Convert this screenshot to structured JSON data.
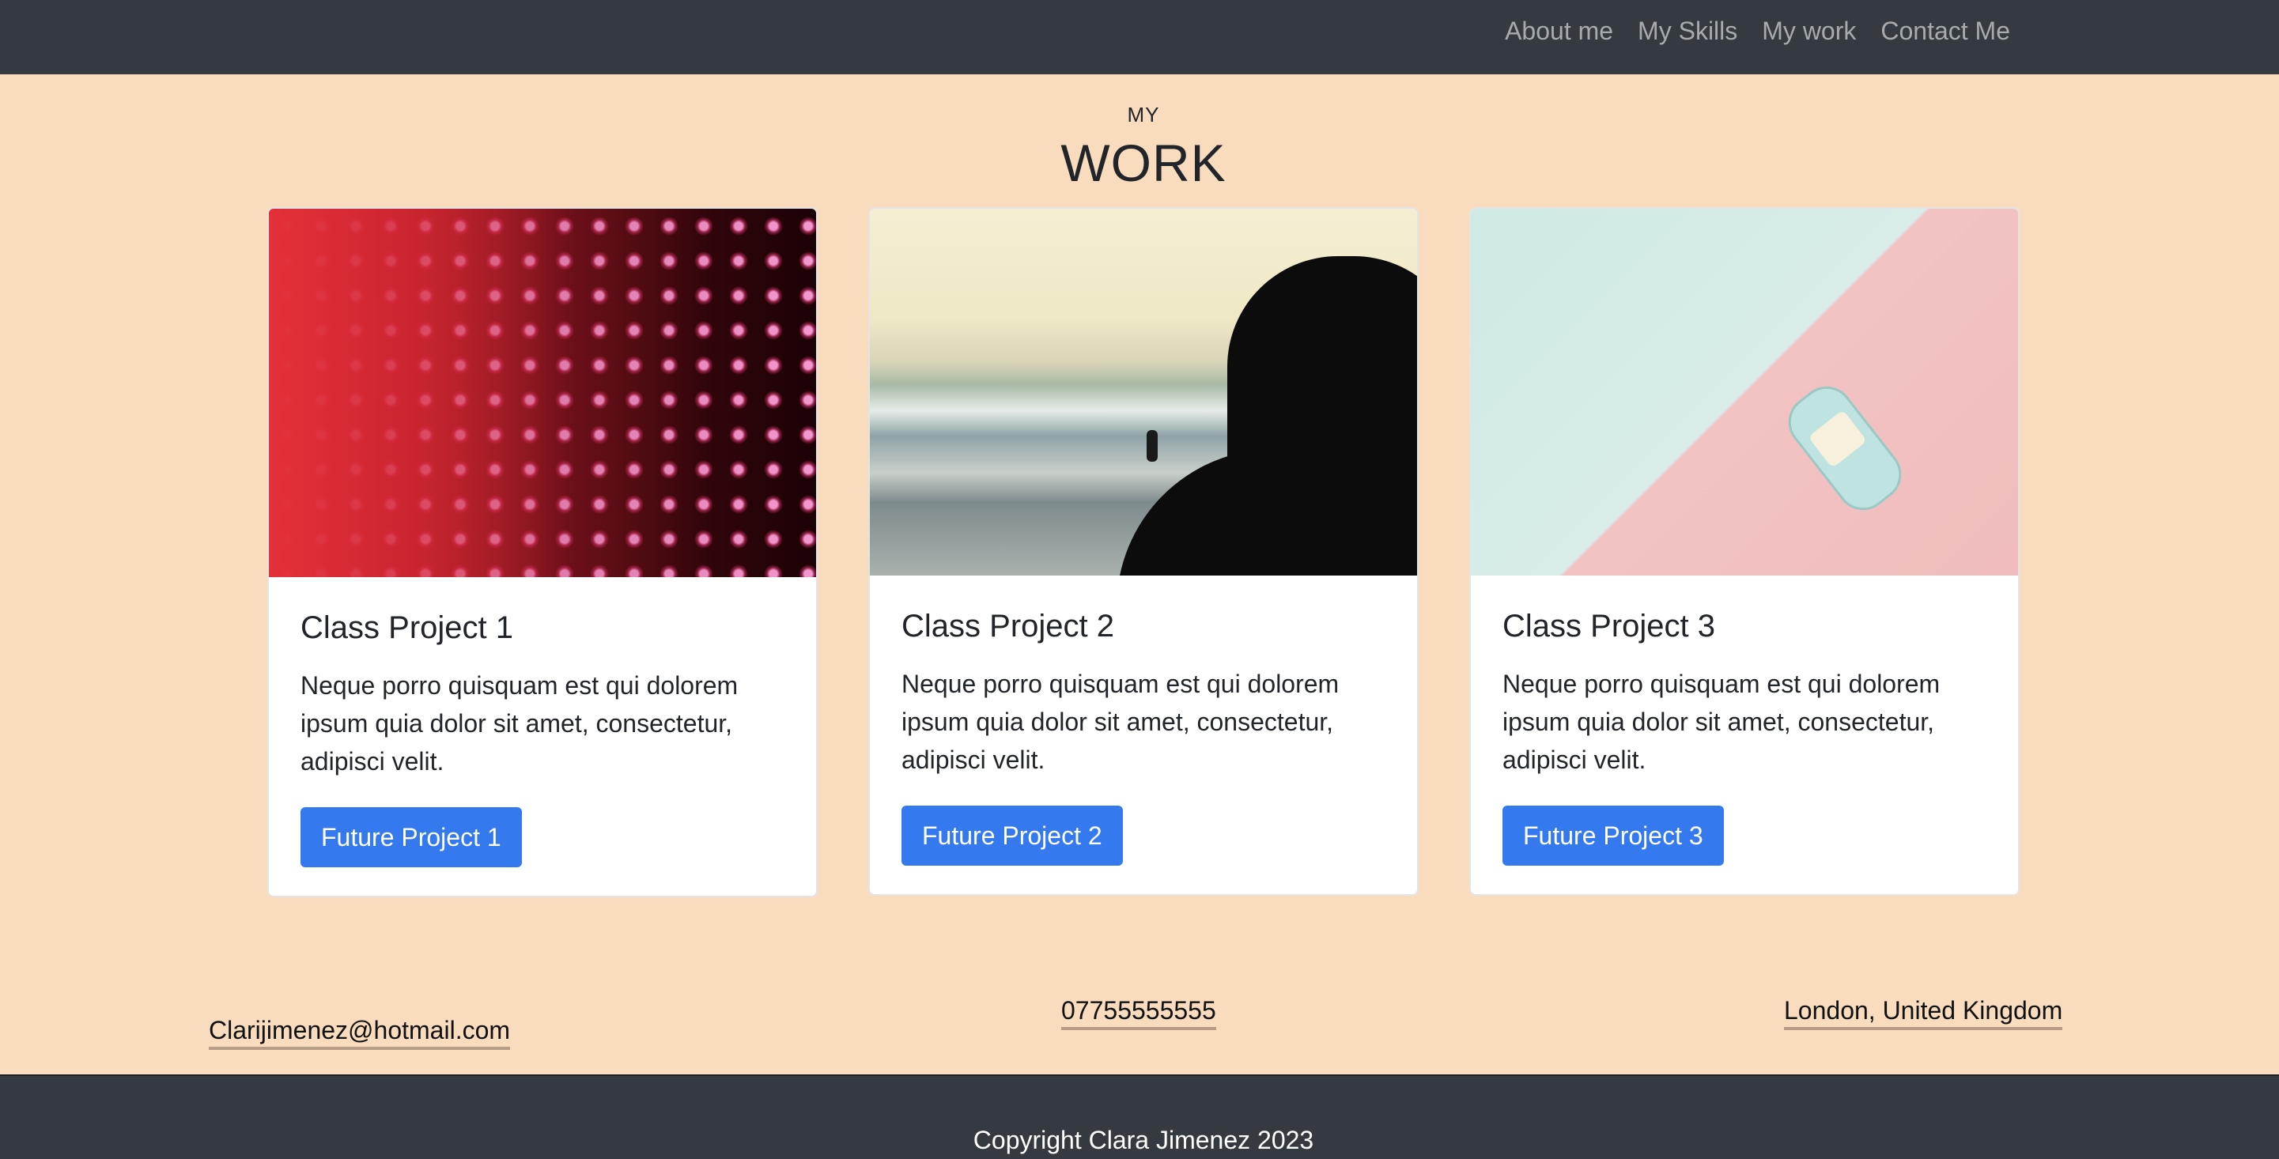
{
  "nav": {
    "items": [
      {
        "label": "About me"
      },
      {
        "label": "My Skills"
      },
      {
        "label": "My work"
      },
      {
        "label": "Contact Me"
      }
    ]
  },
  "section": {
    "subtitle": "MY",
    "title": "WORK"
  },
  "cards": [
    {
      "title": "Class Project 1",
      "text": "Neque porro quisquam est qui dolorem ipsum quia dolor sit amet, consectetur, adipisci velit.",
      "button": "Future Project 1",
      "image": "led-wall-photo"
    },
    {
      "title": "Class Project 2",
      "text": "Neque porro quisquam est qui dolorem ipsum quia dolor sit amet, consectetur, adipisci velit.",
      "button": "Future Project 2",
      "image": "surf-beach-photo"
    },
    {
      "title": "Class Project 3",
      "text": "Neque porro quisquam est qui dolorem ipsum quia dolor sit amet, consectetur, adipisci velit.",
      "button": "Future Project 3",
      "image": "toy-car-photo"
    }
  ],
  "contact": {
    "email": "Clarijimenez@hotmail.com",
    "phone": "07755555555",
    "location": "London, United Kingdom"
  },
  "footer": {
    "copyright": "Copyright Clara Jimenez 2023"
  },
  "colors": {
    "background": "#f9dcbd",
    "navbar": "#343a40",
    "button": "#3479ed"
  }
}
